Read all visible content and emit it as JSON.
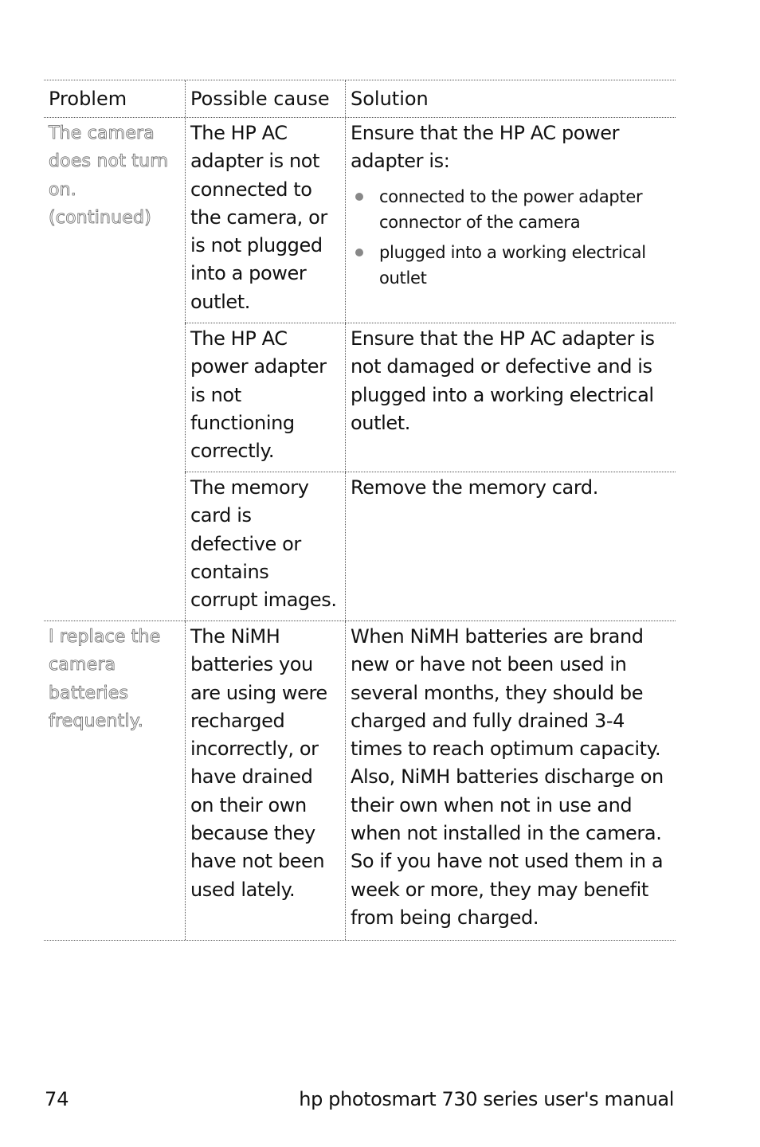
{
  "table": {
    "headers": [
      "Problem",
      "Possible cause",
      "Solution"
    ],
    "groups": [
      {
        "problem": "The camera does not turn on. (continued)",
        "rows": [
          {
            "cause": "The HP AC adapter is not connected to the camera, or is not plugged into a power outlet.",
            "solution": "Ensure that the HP AC power adapter is:",
            "bullets": [
              "connected to the power adapter connector of the camera",
              "plugged into a working electrical outlet"
            ]
          },
          {
            "cause": "The HP AC power adapter is not functioning correctly.",
            "solution": "Ensure that the HP AC adapter is not damaged or defective and is plugged into a working electrical outlet."
          },
          {
            "cause": "The memory card is defective or contains corrupt images.",
            "solution": "Remove the memory card."
          }
        ]
      },
      {
        "problem": "I replace the camera batteries frequently.",
        "rows": [
          {
            "cause": "The NiMH batteries you are using were recharged incorrectly, or have drained on their own because they have not been used lately.",
            "solution": "When NiMH batteries are brand new or have not been used in several months, they should be charged and fully drained 3-4 times to reach optimum capacity. Also, NiMH batteries discharge on their own when not in use and when not installed in the camera. So if you have not used them in a week or more, they may benefit from being charged."
          }
        ]
      }
    ]
  },
  "footer": {
    "page_number": "74",
    "manual_title": "hp photosmart 730 series user's manual"
  }
}
